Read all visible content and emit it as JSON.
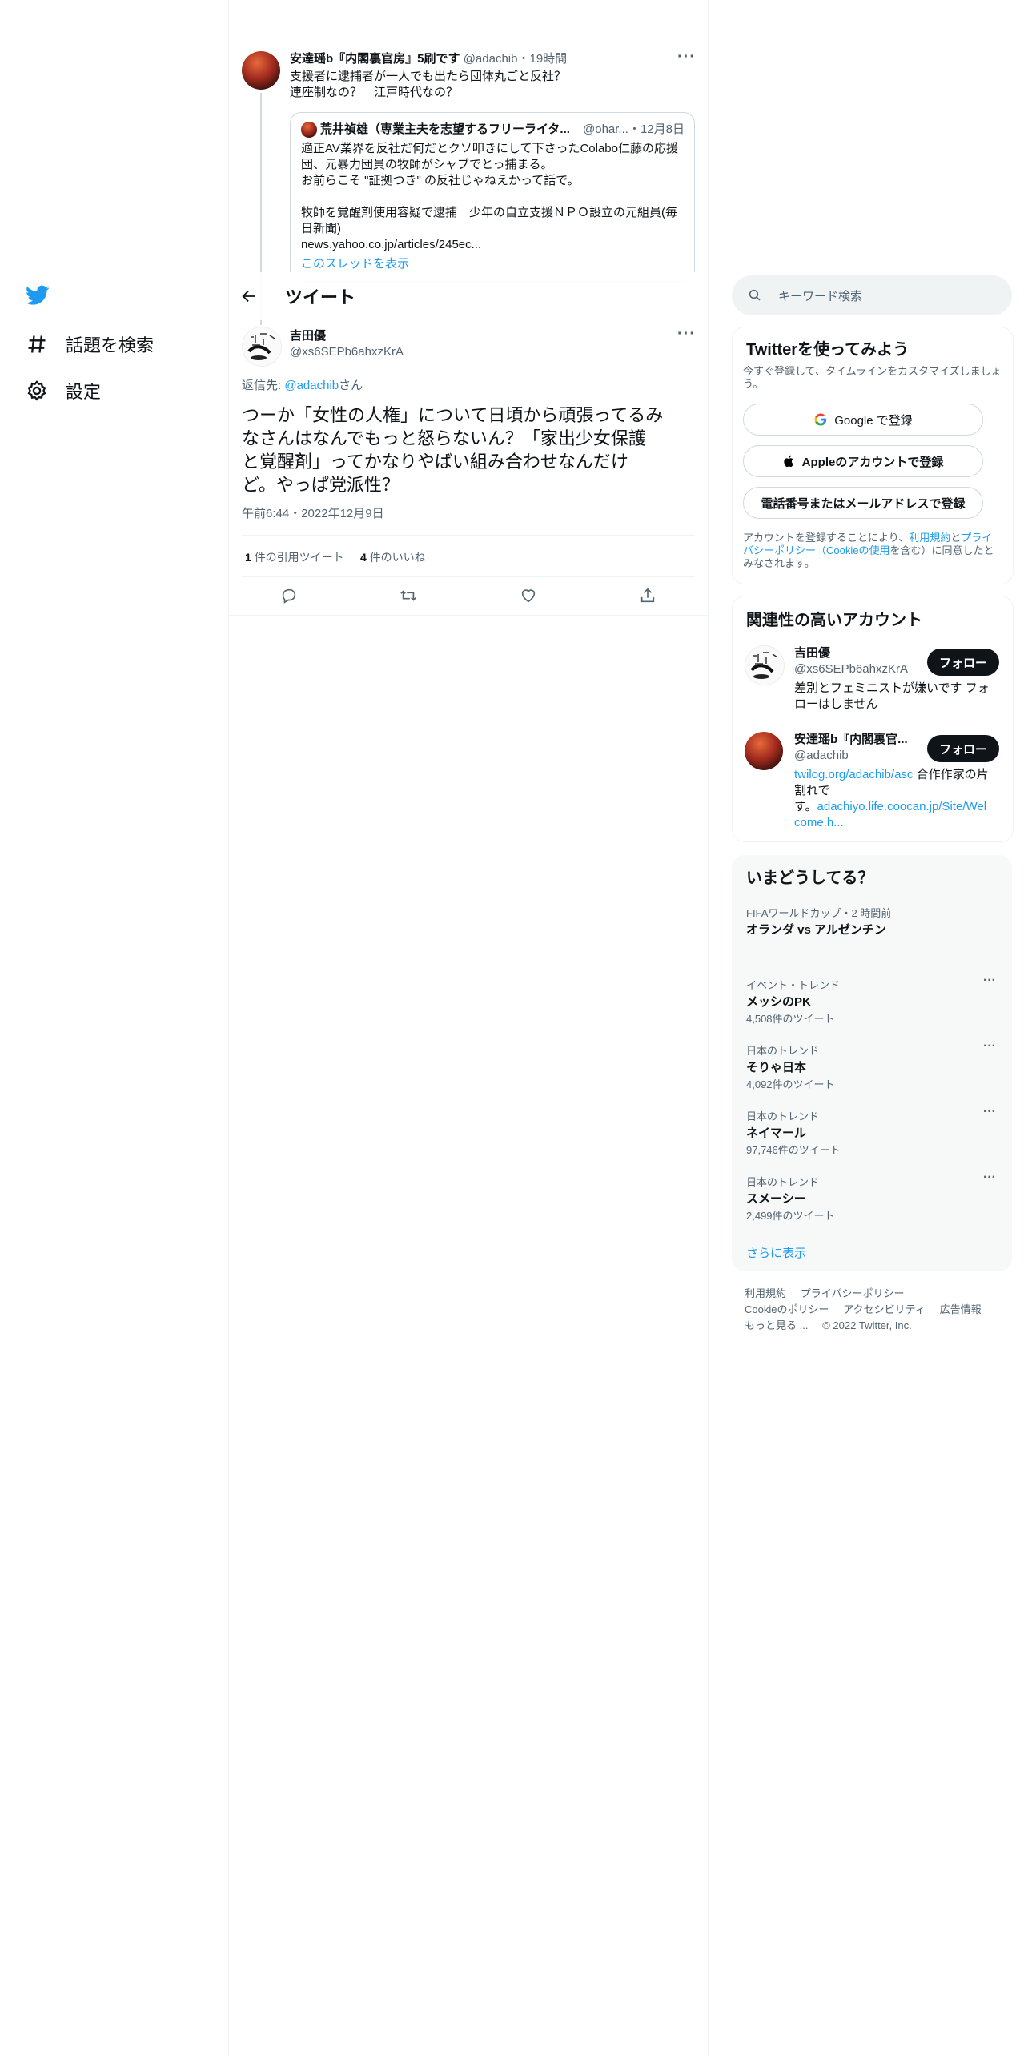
{
  "nav": {
    "explore_label": "話題を検索",
    "settings_label": "設定"
  },
  "header": {
    "title": "ツイート"
  },
  "parent_tweet": {
    "name": "安達瑶b『内閣裏官房』5刷です",
    "handle": "@adachib",
    "time": "19時間",
    "line1": "支援者に逮捕者が一人でも出たら団体丸ごと反社？",
    "line2": "連座制なの？　江戸時代なの？",
    "quote": {
      "name": "荒井禎雄（専業主夫を志望するフリーライタ...",
      "handle": "@ohar...",
      "date": "12月8日",
      "line1": "適正AV業界を反社だ何だとクソ叩きにして下さったColabo仁藤の応援",
      "line2": "団、元暴力団員の牧師がシャブでとっ捕まる。",
      "line3": "お前らこそ \"証拠つき\" の反社じゃねえかって話で。",
      "line4": "牧師を覚醒剤使用容疑で逮捕　少年の自立支援ＮＰＯ設立の元組員(毎",
      "line5": "日新聞)",
      "line6": "news.yahoo.co.jp/articles/245ec..."
    },
    "show_thread": "このスレッドを表示"
  },
  "main_tweet": {
    "name": "吉田優",
    "handle": "@xs6SEPb6ahxzKrA",
    "reply_prefix": "返信先: ",
    "reply_to": "@adachib",
    "reply_suffix": "さん",
    "line1": "つーか「女性の人権」について日頃から頑張ってるみ",
    "line2": "なさんはなんでもっと怒らないん？「家出少女保護",
    "line3": "と覚醒剤」ってかなりやばい組み合わせなんだけ",
    "line4": "ど。やっぱ党派性？",
    "timestamp": "午前6:44・2022年12月9日",
    "quote_count": "1",
    "quote_label": "件の引用ツイート",
    "like_count": "4",
    "like_label": "件のいいね"
  },
  "search": {
    "placeholder": "キーワード検索"
  },
  "signup": {
    "title": "Twitterを使ってみよう",
    "subtitle_line1": "今すぐ登録して、タイムラインをカスタマイズしましょ",
    "subtitle_line2": "う。",
    "google_label": "Google で登録",
    "apple_label": "Appleのアカウントで登録",
    "phone_label": "電話番号またはメールアドレスで登録",
    "terms_line1_a": "アカウントを登録することにより、",
    "terms_line1_b": "利用規約",
    "terms_line1_c": "と",
    "terms_line1_d": "プライ",
    "terms_line2_a": "バシーポリシー",
    "terms_line2_b": "（",
    "terms_line2_c": "Cookieの使用",
    "terms_line2_d": "を含む）に同意したと",
    "terms_line3": "みなされます。"
  },
  "related": {
    "title": "関連性の高いアカウント",
    "accounts": [
      {
        "name": "吉田優",
        "handle": "@xs6SEPb6ahxzKrA",
        "bio_line1": "差別とフェミニストが嫌いです フォ",
        "bio_line2": "ローはしません",
        "follow": "フォロー"
      },
      {
        "name": "安達瑶b『内閣裏官...",
        "handle": "@adachib",
        "bio_link1": "twilog.org/adachib/asc",
        "bio_text1": " 合作作家の片",
        "bio_line2": "割れで",
        "bio_line3a": "す。",
        "bio_link2a": "adachiyo.life.coocan.jp/Site/Wel",
        "bio_link2b": "come.h...",
        "follow": "フォロー"
      }
    ]
  },
  "trends": {
    "title": "いまどうしてる？",
    "items": [
      {
        "category": "FIFAワールドカップ・2 時間前",
        "name": "オランダ vs アルゼンチン",
        "count": ""
      },
      {
        "category": "イベント・トレンド",
        "name": "メッシのPK",
        "count": "4,508件のツイート"
      },
      {
        "category": "日本のトレンド",
        "name": "そりゃ日本",
        "count": "4,092件のツイート"
      },
      {
        "category": "日本のトレンド",
        "name": "ネイマール",
        "count": "97,746件のツイート"
      },
      {
        "category": "日本のトレンド",
        "name": "スメーシー",
        "count": "2,499件のツイート"
      }
    ],
    "show_more": "さらに表示"
  },
  "footer": {
    "terms": "利用規約",
    "privacy": "プライバシーポリシー",
    "cookie": "Cookieのポリシー",
    "accessibility": "アクセシビリティ",
    "ads": "広告情報",
    "more": "もっと見る ...",
    "copyright": "© 2022 Twitter, Inc."
  },
  "colors": {
    "accent": "#1d9bf0",
    "text": "#0f1419",
    "muted": "#536471",
    "border": "#eff3f4",
    "panel": "#f7f9f9"
  }
}
